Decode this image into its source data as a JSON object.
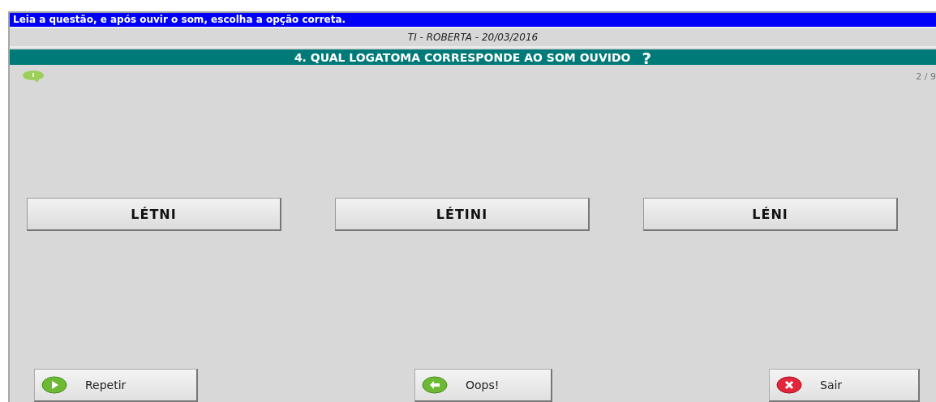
{
  "instruction": "Leia a questão, e após ouvir o som, escolha a opção correta.",
  "subtitle": "TI - ROBERTA - 20/03/2016",
  "question": {
    "title": "4. QUAL LOGATOMA CORRESPONDE AO SOM OUVIDO",
    "help": "?"
  },
  "counter": "2 / 9",
  "options": [
    {
      "label": "LÉTNI"
    },
    {
      "label": "LÉTINI"
    },
    {
      "label": "LÉNI"
    }
  ],
  "actions": [
    {
      "label": "Repetir",
      "kind": "play"
    },
    {
      "label": "Oops!",
      "kind": "back"
    },
    {
      "label": "Sair",
      "kind": "exit"
    }
  ]
}
